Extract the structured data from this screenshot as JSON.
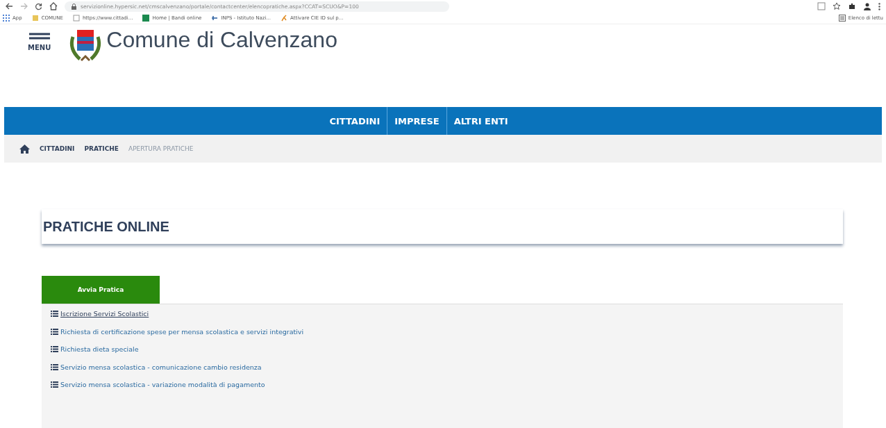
{
  "browser": {
    "url": "servizionline.hypersic.net/cmscalvenzano/portale/contactcenter/elencopratiche.aspx?CCAT=SCUO&P=100",
    "bookmarks": [
      {
        "label": "App",
        "kind": "apps"
      },
      {
        "label": "COMUNE",
        "kind": "folder"
      },
      {
        "label": "https://www.cittadi...",
        "kind": "page"
      },
      {
        "label": "Home | Bandi online",
        "kind": "green"
      },
      {
        "label": "INPS - Istituto Nazi...",
        "kind": "inps"
      },
      {
        "label": "Attivare CIE ID sul p...",
        "kind": "figure"
      }
    ],
    "reading_list": "Elenco di lettu"
  },
  "header": {
    "menu_label": "MENU",
    "site_title": "Comune di Calvenzano"
  },
  "nav": [
    "CITTADINI",
    "IMPRESE",
    "ALTRI ENTI"
  ],
  "breadcrumb": [
    {
      "label": "CITTADINI",
      "current": false
    },
    {
      "label": "PRATICHE",
      "current": false
    },
    {
      "label": "APERTURA PRATICHE",
      "current": true
    }
  ],
  "page_title": "PRATICHE ONLINE",
  "tabs": [
    {
      "label": "Avvia Pratica",
      "selected": true
    }
  ],
  "items": [
    {
      "label": "Iscrizione Servizi Scolastici",
      "selected": true
    },
    {
      "label": "Richiesta di certificazione spese per mensa scolastica e servizi integrativi",
      "selected": false
    },
    {
      "label": "Richiesta dieta speciale",
      "selected": false
    },
    {
      "label": "Servizio mensa scolastica - comunicazione cambio residenza",
      "selected": false
    },
    {
      "label": "Servizio mensa scolastica - variazione modalità di pagamento",
      "selected": false
    }
  ]
}
